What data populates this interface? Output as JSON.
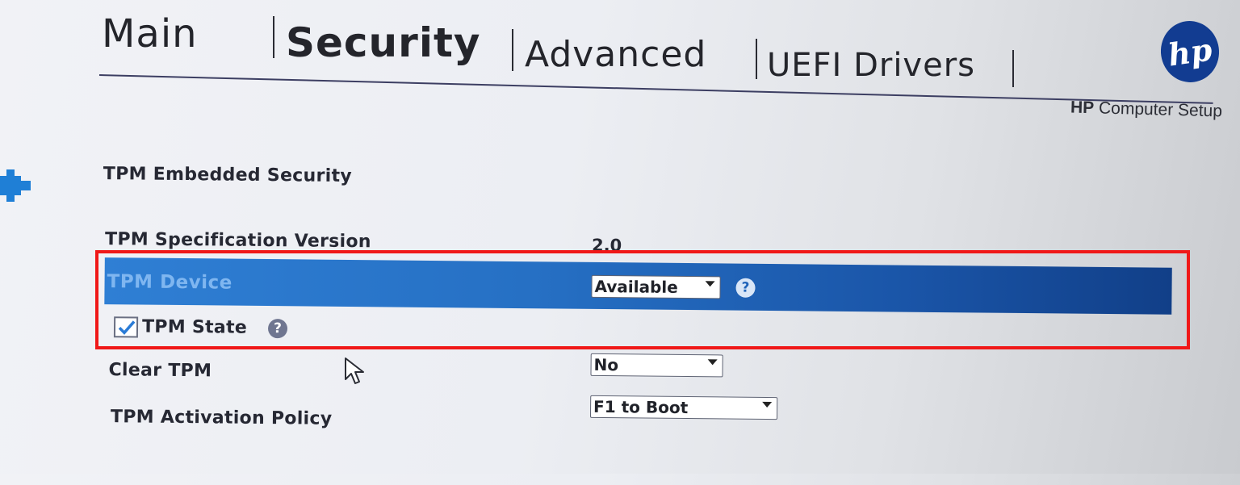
{
  "tabs": [
    {
      "label": "Main"
    },
    {
      "label": "Security"
    },
    {
      "label": "Advanced"
    },
    {
      "label": "UEFI Drivers"
    }
  ],
  "brand": {
    "logo_text": "hp",
    "app_name_bold": "HP",
    "app_name_rest": " Computer Setup"
  },
  "section": {
    "title": "TPM Embedded Security"
  },
  "settings": {
    "spec_version": {
      "label": "TPM Specification Version",
      "value": "2.0"
    },
    "tpm_device": {
      "label": "TPM Device",
      "value": "Available",
      "selected": true
    },
    "tpm_state": {
      "label": "TPM State",
      "checked": true
    },
    "clear_tpm": {
      "label": "Clear TPM",
      "value": "No"
    },
    "activation_policy": {
      "label": "TPM Activation Policy",
      "value": "F1 to Boot"
    }
  },
  "help_glyph": "?",
  "colors": {
    "selection": "#2670c4",
    "highlight_box": "#f01818",
    "brand": "#123c91"
  },
  "icons": [
    "hp-logo",
    "back-arrow-icon",
    "help-icon",
    "checkmark-icon",
    "mouse-cursor-icon",
    "chevron-down-icon"
  ]
}
